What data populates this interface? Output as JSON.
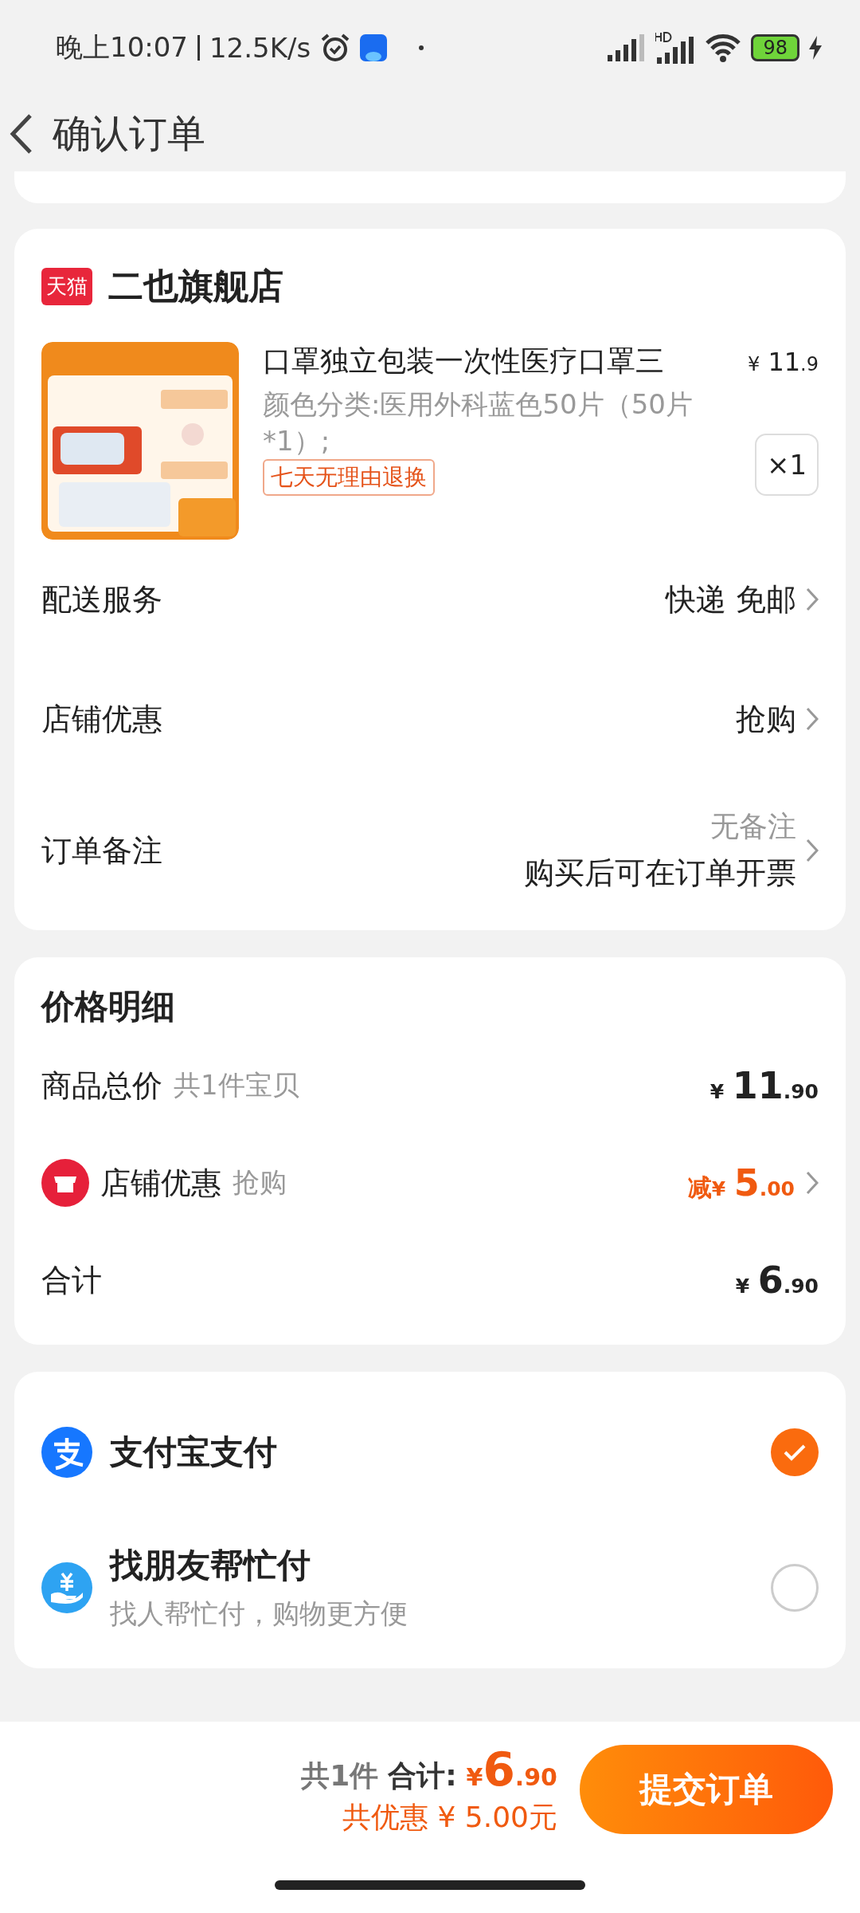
{
  "status_bar": {
    "time": "晚上10:07",
    "speed": "12.5K/s",
    "battery": "98"
  },
  "header": {
    "title": "确认订单"
  },
  "shop": {
    "badge": "天猫",
    "name": "二也旗舰店",
    "product": {
      "title": "口罩独立包装一次性医疗口罩三",
      "spec": "颜色分类:医用外科蓝色50片（50片*1）;",
      "tag": "七天无理由退换",
      "price": {
        "symbol": "¥",
        "int": "11",
        "dec": ".9"
      },
      "quantity": "×1"
    },
    "rows": [
      {
        "label": "配送服务",
        "values": [
          "快递 免邮"
        ]
      },
      {
        "label": "店铺优惠",
        "values": [
          "抢购"
        ]
      },
      {
        "label": "订单备注",
        "values": [
          "无备注",
          "购买后可在订单开票"
        ]
      }
    ]
  },
  "price_detail": {
    "title": "价格明细",
    "rows": [
      {
        "kind": "plain",
        "label": "商品总价",
        "note": "共1件宝贝",
        "price": {
          "symbol": "¥",
          "int": "11",
          "dec": ".90"
        }
      },
      {
        "kind": "discount",
        "label": "店铺优惠",
        "note": "抢购",
        "prefix": "减",
        "price": {
          "symbol": "¥",
          "int": "5",
          "dec": ".00"
        }
      },
      {
        "kind": "plain",
        "label": "合计",
        "price": {
          "symbol": "¥",
          "int": "6",
          "dec": ".90"
        }
      }
    ]
  },
  "payment": [
    {
      "kind": "alipay",
      "name": "支付宝支付",
      "selected": true
    },
    {
      "kind": "friend",
      "name": "找朋友帮忙付",
      "subtitle": "找人帮忙付，购物更方便",
      "selected": false
    }
  ],
  "bottom_bar": {
    "count": "共1件",
    "total_label": "合计:",
    "total": {
      "symbol": "¥",
      "int": "6",
      "dec": ".90"
    },
    "saving": "共优惠 ¥ 5.00元",
    "submit": "提交订单"
  }
}
